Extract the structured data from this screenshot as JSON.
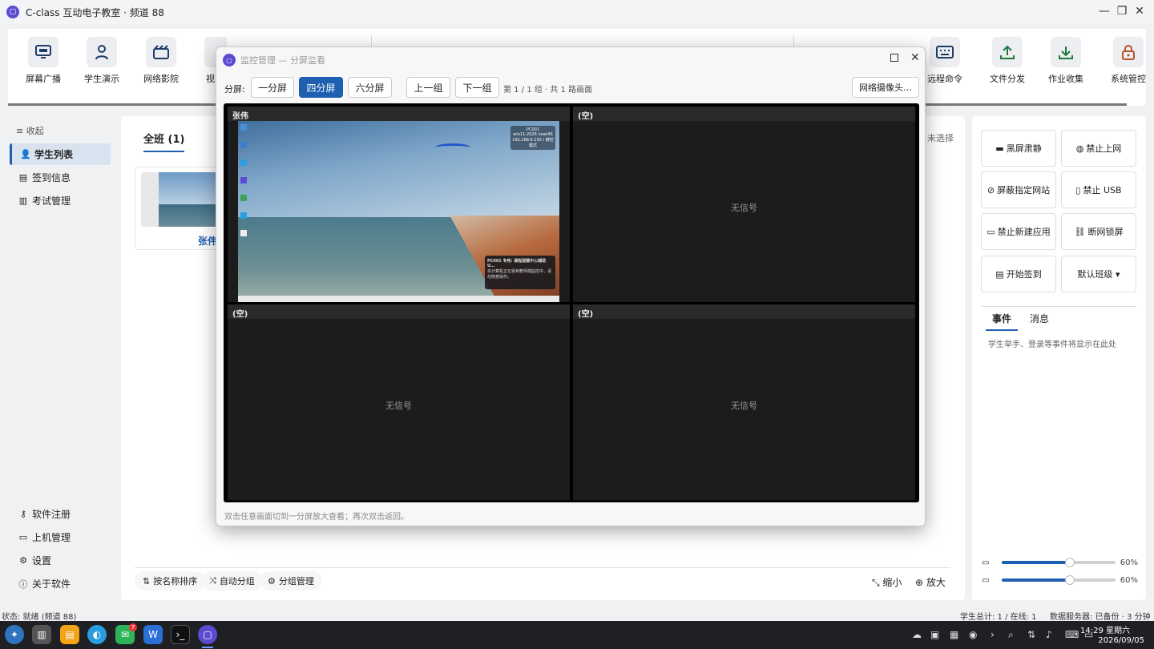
{
  "window": {
    "title": "C-class 互动电子教室 · 频道 88",
    "min": "—",
    "max": "❐",
    "close": "✕"
  },
  "toolbar": {
    "items": [
      {
        "label": "屏幕广播",
        "icon": "monitor-icon"
      },
      {
        "label": "学生演示",
        "icon": "person-icon"
      },
      {
        "label": "网络影院",
        "icon": "cinema-icon"
      },
      {
        "label": "视",
        "icon": "video-icon"
      },
      {
        "label": "远程命令",
        "icon": "keyboard-icon"
      },
      {
        "label": "文件分发",
        "icon": "upload-icon"
      },
      {
        "label": "作业收集",
        "icon": "download-icon"
      },
      {
        "label": "系统管控",
        "icon": "lock-icon"
      }
    ]
  },
  "sidebar": {
    "collapse": "收起",
    "items": [
      {
        "label": "学生列表",
        "icon": "person-icon"
      },
      {
        "label": "签到信息",
        "icon": "clipboard-icon"
      },
      {
        "label": "考试管理",
        "icon": "document-icon"
      }
    ],
    "bottom_items": [
      {
        "label": "软件注册",
        "icon": "key-icon"
      },
      {
        "label": "上机管理",
        "icon": "card-icon"
      },
      {
        "label": "设置",
        "icon": "gear-icon"
      },
      {
        "label": "关于软件",
        "icon": "info-icon"
      }
    ]
  },
  "center": {
    "tab": "全班 (1)",
    "selection": "未选择",
    "student_name": "张伟",
    "bottom_buttons": [
      "按名称排序",
      "自动分组",
      "分组管理"
    ],
    "zoom_out": "缩小",
    "zoom_in": "放大"
  },
  "right": {
    "buttons": [
      "黑屏肃静",
      "禁止上网",
      "屏蔽指定网站",
      "禁止 USB",
      "禁止新建应用",
      "断网锁屏",
      "开始签到",
      "默认班级 ▾"
    ],
    "tabs": [
      "事件",
      "消息"
    ],
    "event_hint": "学生举手、登录等事件将显示在此处",
    "sliders": [
      {
        "value": 60,
        "label": "60%"
      },
      {
        "value": 60,
        "label": "60%"
      }
    ]
  },
  "status": {
    "left": "状态: 就绪 (频道 88)",
    "right": "学生总计: 1 / 在线: 1",
    "server": "数据服务器: 已备份 · 3 分钟前"
  },
  "taskbar": {
    "time": "14:29 星期六",
    "date": "2026/09/05",
    "badge": "7"
  },
  "dialog": {
    "title": "监控管理 — 分屏监看",
    "split_label": "分屏:",
    "split_buttons": [
      "一分屏",
      "四分屏",
      "六分屏"
    ],
    "prev": "上一组",
    "next": "下一组",
    "page_info": "第 1 / 1 组 · 共 1 路画面",
    "camera": "网络摄像头…",
    "panes": [
      {
        "title": "张伟",
        "nosig": ""
      },
      {
        "title": "(空)",
        "nosig": "无信号"
      },
      {
        "title": "(空)",
        "nosig": "无信号"
      },
      {
        "title": "(空)",
        "nosig": "无信号"
      }
    ],
    "remote": {
      "pc_name": "PC001",
      "os": "win11-2026 new/46",
      "ip": "192.168.6.150 / 被控模式",
      "toast_title": "PC001 专用: 课程提醒中心辅助U…",
      "toast_body": "本计算机正在受到教师端监控中，请勿随意操作。"
    },
    "hint": "双击任意画面切到一分屏放大查看；再次双击返回。"
  },
  "colors": {
    "accent": "#1f5fb0",
    "brand": "#5b4bd1"
  }
}
